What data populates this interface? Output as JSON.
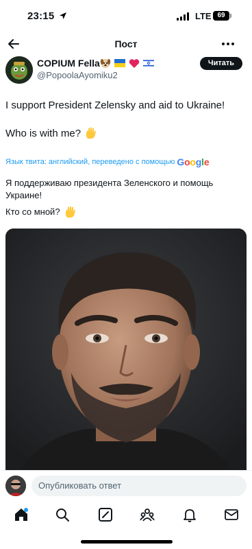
{
  "status_bar": {
    "time": "23:15",
    "network": "LTE",
    "battery": "69"
  },
  "header": {
    "title": "Пост"
  },
  "author": {
    "name": "COPIUM Fella",
    "handle": "@PopoolaAyomiku2",
    "badges": [
      "dog-emoji",
      "ukraine-flag",
      "red-heart",
      "israel-flag"
    ],
    "follow_label": "Читать"
  },
  "tweet": {
    "line1": "I support President Zelensky and aid to Ukraine!",
    "line2": "Who is with me?"
  },
  "translation": {
    "info": "Язык твита: английский, переведено с помощью",
    "provider": "Google",
    "provider_colors": [
      "#4285F4",
      "#EA4335",
      "#FBBC05",
      "#4285F4",
      "#34A853",
      "#EA4335"
    ],
    "line1": "Я поддерживаю президента Зеленского и помощь",
    "line2": "Украине!",
    "line3": "Кто со мной?"
  },
  "reply": {
    "placeholder": "Опубликовать ответ"
  },
  "tabs": [
    "home-icon",
    "search-icon",
    "grok-icon",
    "communities-icon",
    "notifications-icon",
    "messages-icon"
  ]
}
